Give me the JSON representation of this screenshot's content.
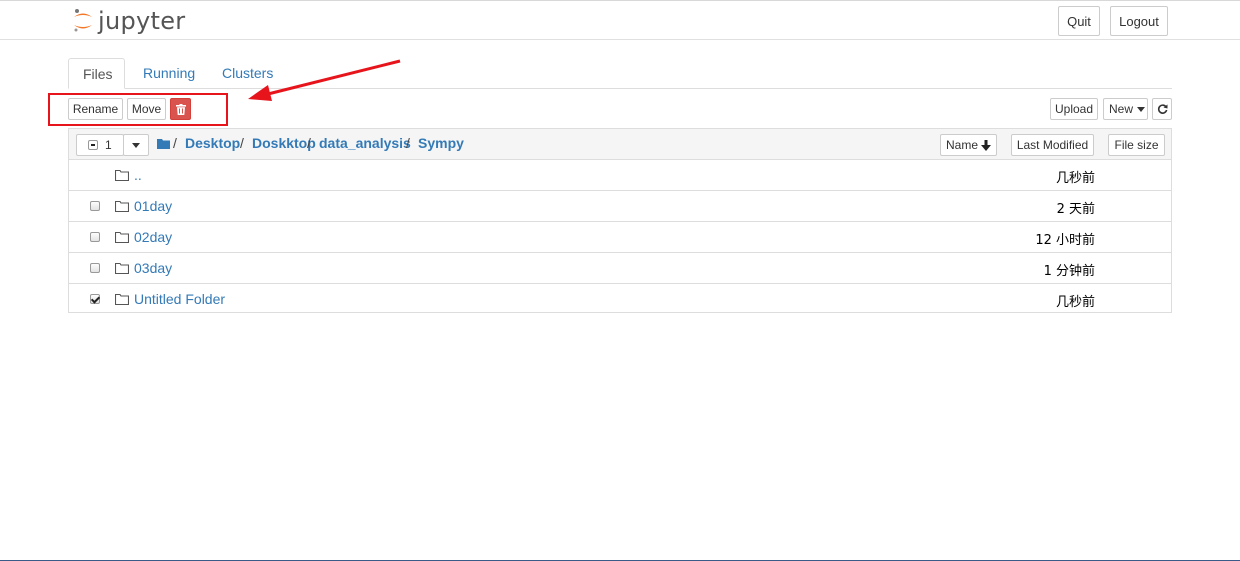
{
  "header": {
    "logo_text": "jupyter",
    "quit": "Quit",
    "logout": "Logout"
  },
  "tabs": [
    "Files",
    "Running",
    "Clusters"
  ],
  "toolbar": {
    "rename": "Rename",
    "move": "Move",
    "upload": "Upload",
    "new": "New"
  },
  "list_header": {
    "selected_count": "1",
    "breadcrumb": [
      "Desktop",
      "Doskktop",
      "data_analysis",
      "Sympy"
    ],
    "sort_name": "Name",
    "last_modified": "Last Modified",
    "file_size": "File size"
  },
  "rows": [
    {
      "name": "..",
      "modified": "几秒前",
      "checkbox": false,
      "checked": false
    },
    {
      "name": "01day",
      "modified": "2 天前",
      "checkbox": true,
      "checked": false
    },
    {
      "name": "02day",
      "modified": "12 小时前",
      "checkbox": true,
      "checked": false
    },
    {
      "name": "03day",
      "modified": "1 分钟前",
      "checkbox": true,
      "checked": false
    },
    {
      "name": "Untitled Folder",
      "modified": "几秒前",
      "checkbox": true,
      "checked": true
    }
  ],
  "colors": {
    "link": "#337ab7",
    "danger": "#d9534f",
    "annotation": "#e8141c"
  },
  "icons": [
    "jupyter-logo-icon",
    "trash-icon",
    "caret-down-icon",
    "folder-icon",
    "arrow-down-icon",
    "refresh-icon",
    "annotation-arrow"
  ]
}
